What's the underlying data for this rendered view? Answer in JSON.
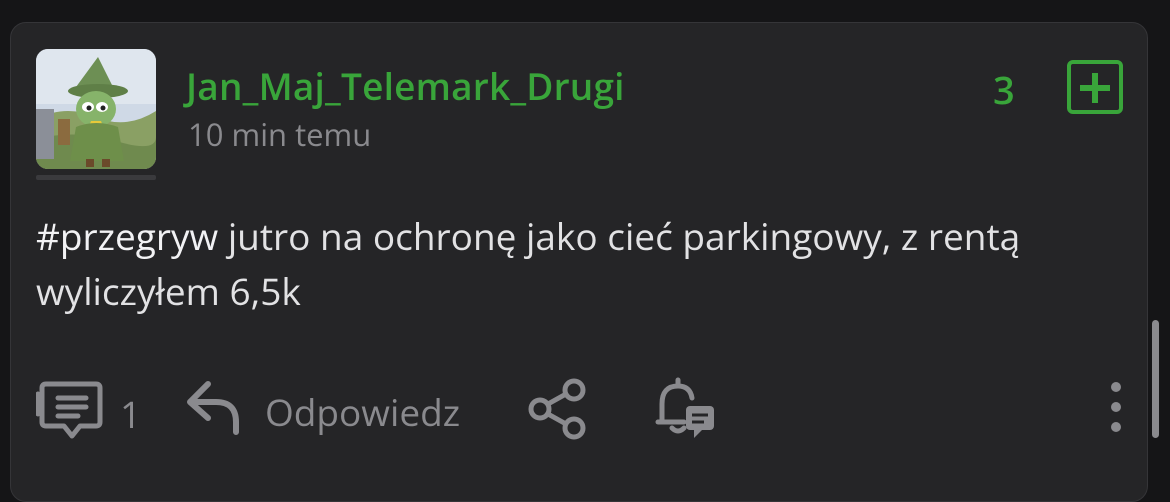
{
  "post": {
    "author": "Jan_Maj_Telemark_Drugi",
    "time": "10 min temu",
    "votes": "3",
    "tag": "#przegryw",
    "text": " jutro na ochronę jako cieć parkingowy, z rentą wyliczyłem 6,5k"
  },
  "actions": {
    "comments_count": "1",
    "reply_label": "Odpowiedz"
  },
  "icons": {
    "avatar": "avatar-image",
    "upvote": "plus-square-icon",
    "comments": "comment-icon",
    "reply": "reply-arrow-icon",
    "share": "share-icon",
    "notify": "bell-comment-icon",
    "more": "more-vertical-icon"
  },
  "colors": {
    "accent": "#39a53a",
    "background": "#252527",
    "muted": "#8a8a8e",
    "text": "#e2e2e4"
  }
}
